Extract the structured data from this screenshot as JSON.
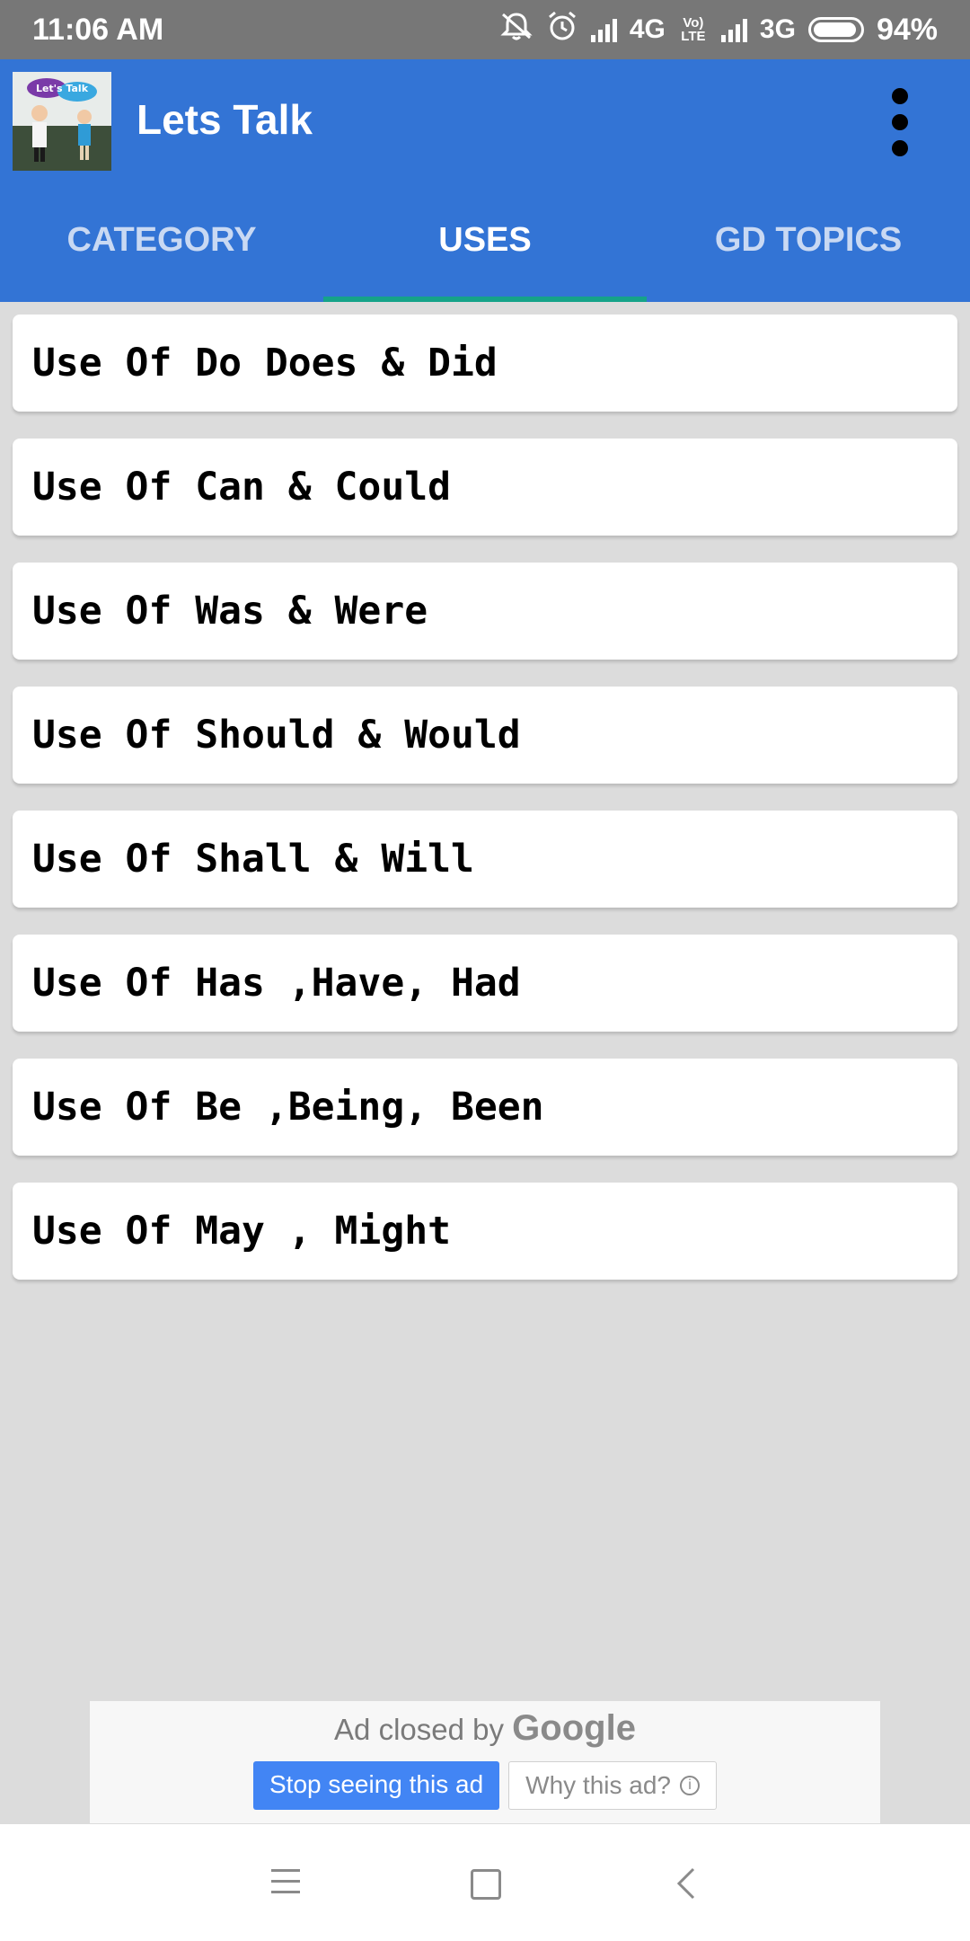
{
  "status_bar": {
    "time": "11:06 AM",
    "network_1": "4G",
    "volte": "Vo) LTE",
    "network_2": "3G",
    "battery": "94%",
    "battery_level": 0.94,
    "icons": [
      "mute-icon",
      "alarm-icon",
      "signal-icon",
      "signal-icon",
      "battery-icon"
    ]
  },
  "app_bar": {
    "title": "Lets Talk",
    "logo_text": "Let's Talk",
    "tabs": [
      {
        "label": "CATEGORY",
        "active": false
      },
      {
        "label": "USES",
        "active": true
      },
      {
        "label": "GD TOPICS",
        "active": false
      }
    ],
    "colors": {
      "primary": "#3374d5",
      "tab_indicator": "#15a389"
    }
  },
  "list": {
    "items": [
      "Use Of Do Does & Did",
      "Use Of Can & Could",
      "Use Of Was & Were",
      "Use Of Should & Would",
      "Use Of Shall & Will",
      "Use Of Has ,Have, Had",
      "Use Of Be ,Being, Been",
      "Use Of May , Might"
    ]
  },
  "ad": {
    "closed_text": "Ad closed by",
    "brand": "Google",
    "stop_label": "Stop seeing this ad",
    "why_label": "Why this ad?",
    "stop_color": "#4285f4"
  },
  "nav_bar": {
    "icons": [
      "menu-icon",
      "home-icon",
      "back-icon"
    ]
  }
}
